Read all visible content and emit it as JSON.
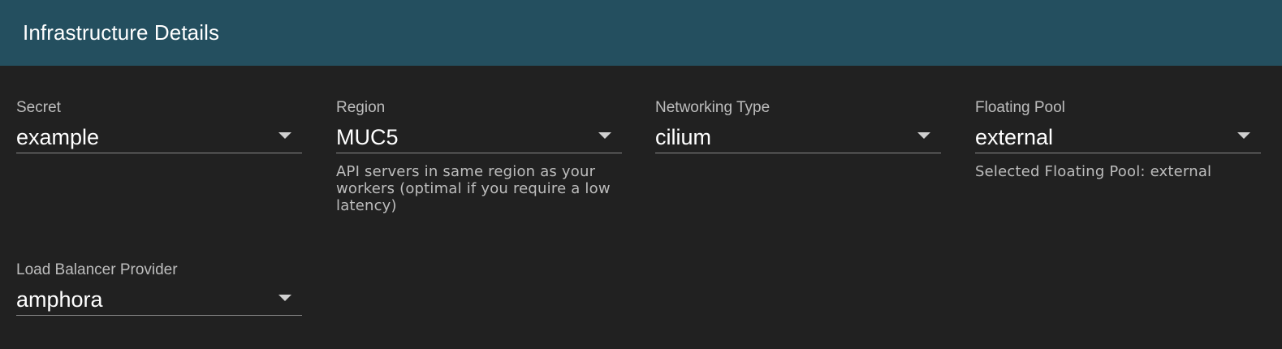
{
  "header": {
    "title": "Infrastructure Details"
  },
  "fields": {
    "secret": {
      "label": "Secret",
      "value": "example"
    },
    "region": {
      "label": "Region",
      "value": "MUC5",
      "hint": "API servers in same region as your workers (optimal if you require a low latency)"
    },
    "networking_type": {
      "label": "Networking Type",
      "value": "cilium"
    },
    "floating_pool": {
      "label": "Floating Pool",
      "value": "external",
      "hint": "Selected Floating Pool: external"
    },
    "load_balancer_provider": {
      "label": "Load Balancer Provider",
      "value": "amphora"
    }
  },
  "colors": {
    "header_bg": "#244f5f",
    "panel_bg": "#212121",
    "text_primary": "#ffffff",
    "text_secondary": "#bdbdbd"
  }
}
